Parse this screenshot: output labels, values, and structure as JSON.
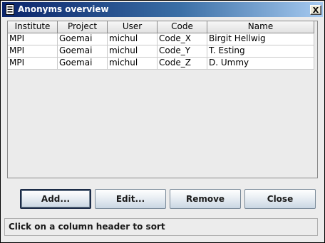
{
  "window": {
    "title": "Anonyms overview",
    "close_label": "X"
  },
  "table": {
    "columns": [
      "Institute",
      "Project",
      "User",
      "Code",
      "Name"
    ],
    "rows": [
      [
        "MPI",
        "Goemai",
        "michul",
        "Code_X",
        "Birgit Hellwig"
      ],
      [
        "MPI",
        "Goemai",
        "michul",
        "Code_Y",
        "T. Esting"
      ],
      [
        "MPI",
        "Goemai",
        "michul",
        "Code_Z",
        "D. Ummy"
      ]
    ]
  },
  "buttons": {
    "add": "Add...",
    "edit": "Edit...",
    "remove": "Remove",
    "close": "Close"
  },
  "status": {
    "text": "Click on a column header to sort"
  }
}
